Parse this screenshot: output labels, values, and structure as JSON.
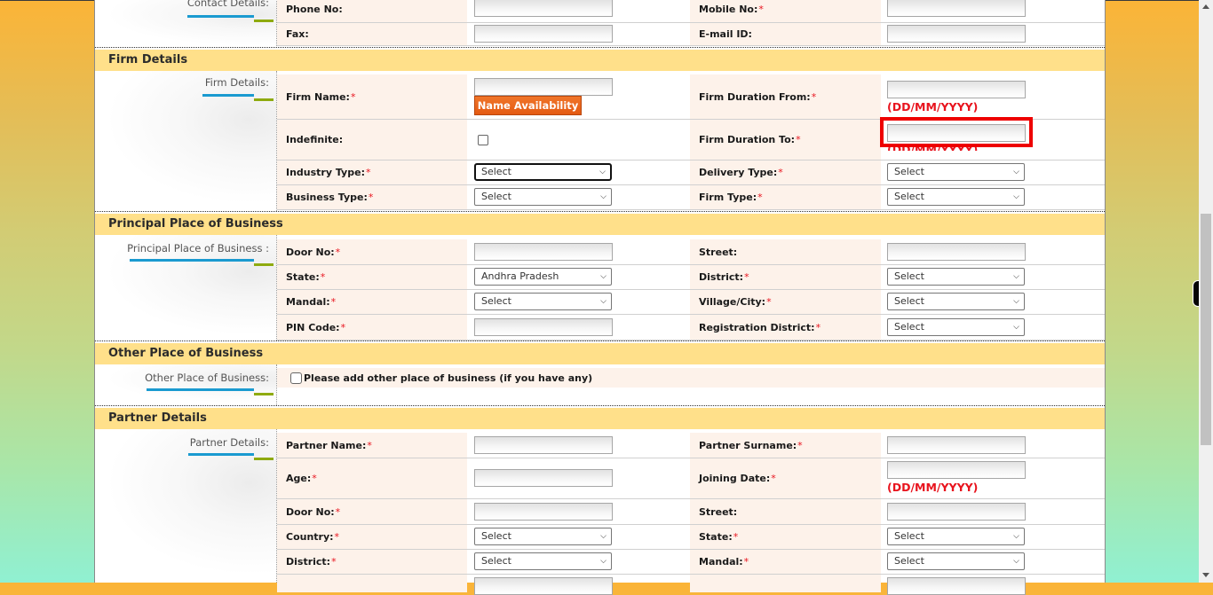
{
  "contact_section": {
    "side_label": "Contact Details:",
    "rows": [
      {
        "left_label": "Phone No:",
        "left_required": false,
        "left_value": "",
        "right_label": "Mobile No:",
        "right_required": true,
        "right_value": ""
      },
      {
        "left_label": "Fax:",
        "left_required": false,
        "left_value": "",
        "right_label": "E-mail ID:",
        "right_required": false,
        "right_value": ""
      }
    ]
  },
  "firm_section": {
    "title": "Firm Details",
    "side_label": "Firm Details:",
    "firm_name_label": "Firm Name:",
    "firm_name_value": "",
    "name_availability_button": "Name Availability",
    "firm_duration_from_label": "Firm Duration From:",
    "firm_duration_from_value": "",
    "date_format_hint": "(DD/MM/YYYY)",
    "indefinite_label": "Indefinite:",
    "indefinite_checked": false,
    "firm_duration_to_label": "Firm Duration To:",
    "firm_duration_to_value": "",
    "industry_type_label": "Industry Type:",
    "industry_type_value": "Select",
    "delivery_type_label": "Delivery Type:",
    "delivery_type_value": "Select",
    "business_type_label": "Business Type:",
    "business_type_value": "Select",
    "firm_type_label": "Firm Type:",
    "firm_type_value": "Select"
  },
  "principal_section": {
    "title": "Principal Place of Business",
    "side_label": "Principal Place of Business :",
    "door_no_label": "Door No:",
    "door_no_value": "",
    "street_label": "Street:",
    "street_value": "",
    "state_label": "State:",
    "state_value": "Andhra Pradesh",
    "district_label": "District:",
    "district_value": "Select",
    "mandal_label": "Mandal:",
    "mandal_value": "Select",
    "village_label": "Village/City:",
    "village_value": "Select",
    "pin_label": "PIN Code:",
    "pin_value": "",
    "reg_district_label": "Registration District:",
    "reg_district_value": "Select"
  },
  "other_section": {
    "title": "Other Place of Business",
    "side_label": "Other Place of Business:",
    "checkbox_label": "Please add other place of business (if you have any)",
    "checked": false
  },
  "partner_section": {
    "title": "Partner Details",
    "side_label": "Partner Details:",
    "partner_name_label": "Partner Name:",
    "partner_name_value": "",
    "partner_surname_label": "Partner Surname:",
    "partner_surname_value": "",
    "age_label": "Age:",
    "age_value": "",
    "joining_date_label": "Joining Date:",
    "joining_date_value": "",
    "date_format_hint": "(DD/MM/YYYY)",
    "door_no_label": "Door No:",
    "door_no_value": "",
    "street_label": "Street:",
    "street_value": "",
    "country_label": "Country:",
    "country_value": "Select",
    "state_label": "State:",
    "state_value": "Select",
    "district_label": "District:",
    "district_value": "Select",
    "mandal_label": "Mandal:",
    "mandal_value": "Select"
  },
  "required_marker": "*",
  "chevron_glyph": "❯",
  "colors": {
    "section_header": "#ffe08a",
    "label_bg": "#fdf2ea",
    "required": "#e8141e",
    "button": "#e45a12",
    "highlight": "#ee0000"
  }
}
